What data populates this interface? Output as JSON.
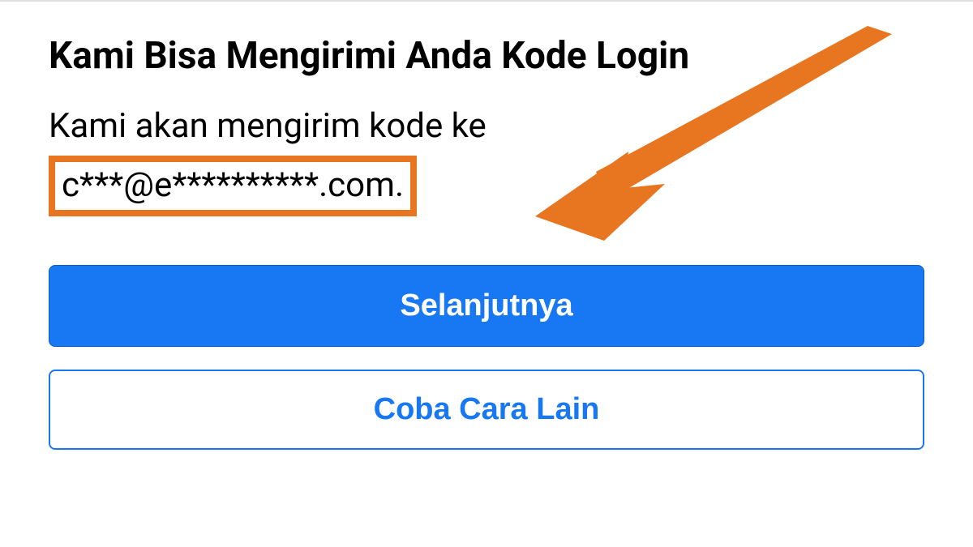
{
  "header": {
    "title": "Kami Bisa Mengirimi Anda Kode Login"
  },
  "body": {
    "description_prefix": "Kami akan mengirim kode ke",
    "masked_email": "c***@e**********.com."
  },
  "buttons": {
    "primary_label": "Selanjutnya",
    "secondary_label": "Coba Cara Lain"
  },
  "annotation": {
    "highlight_color": "#e87520"
  }
}
